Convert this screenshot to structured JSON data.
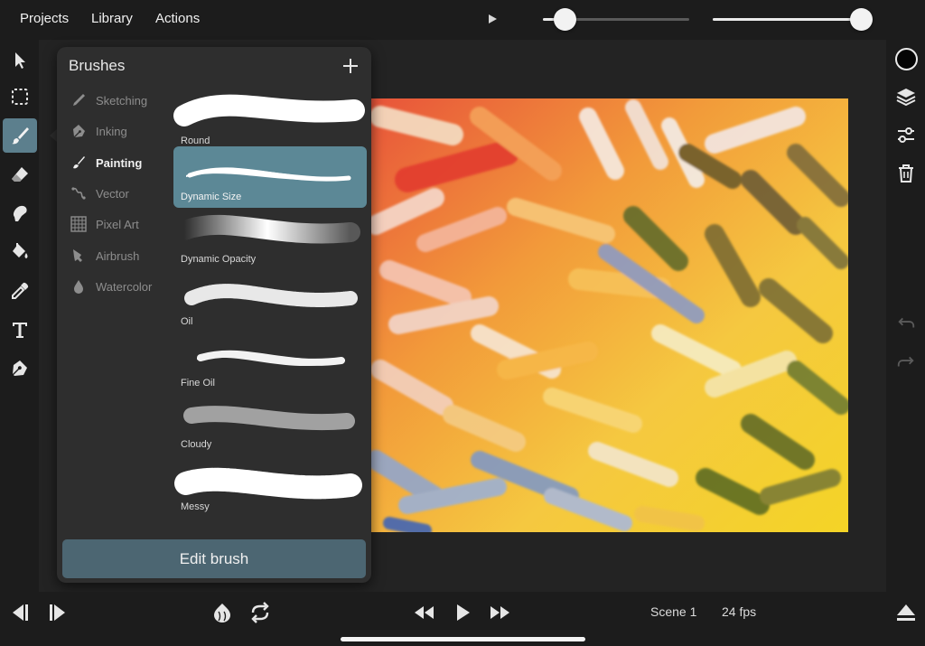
{
  "menu": {
    "projects": "Projects",
    "library": "Library",
    "actions": "Actions"
  },
  "transport": {
    "slider1_value": 0.15,
    "slider2_value": 0.93
  },
  "tools": [
    {
      "name": "select-arrow-icon"
    },
    {
      "name": "marquee-select-icon"
    },
    {
      "name": "brush-icon",
      "active": true
    },
    {
      "name": "eraser-icon"
    },
    {
      "name": "smudge-icon"
    },
    {
      "name": "fill-bucket-icon"
    },
    {
      "name": "eyedropper-icon"
    },
    {
      "name": "text-icon"
    },
    {
      "name": "pen-icon"
    }
  ],
  "panel": {
    "title": "Brushes",
    "categories": [
      {
        "label": "Sketching",
        "icon": "pencil-icon"
      },
      {
        "label": "Inking",
        "icon": "ink-pen-icon"
      },
      {
        "label": "Painting",
        "icon": "paintbrush-icon",
        "active": true
      },
      {
        "label": "Vector",
        "icon": "vector-icon"
      },
      {
        "label": "Pixel Art",
        "icon": "pixel-grid-icon"
      },
      {
        "label": "Airbrush",
        "icon": "airbrush-icon"
      },
      {
        "label": "Watercolor",
        "icon": "droplet-icon"
      }
    ],
    "brushes": [
      {
        "label": "Round"
      },
      {
        "label": "Dynamic Size",
        "selected": true
      },
      {
        "label": "Dynamic Opacity"
      },
      {
        "label": "Oil"
      },
      {
        "label": "Fine Oil"
      },
      {
        "label": "Cloudy"
      },
      {
        "label": "Messy"
      }
    ],
    "edit_label": "Edit brush"
  },
  "right_tools": [
    {
      "name": "color-swatch"
    },
    {
      "name": "layers-icon"
    },
    {
      "name": "adjustments-icon"
    },
    {
      "name": "trash-icon"
    },
    {
      "name": "undo-icon"
    },
    {
      "name": "redo-icon"
    }
  ],
  "bottom": {
    "scene": "Scene 1",
    "fps": "24 fps"
  },
  "colors": {
    "accent": "#5c8896",
    "edit_button": "#4c6672",
    "background": "#1a1a1a"
  }
}
